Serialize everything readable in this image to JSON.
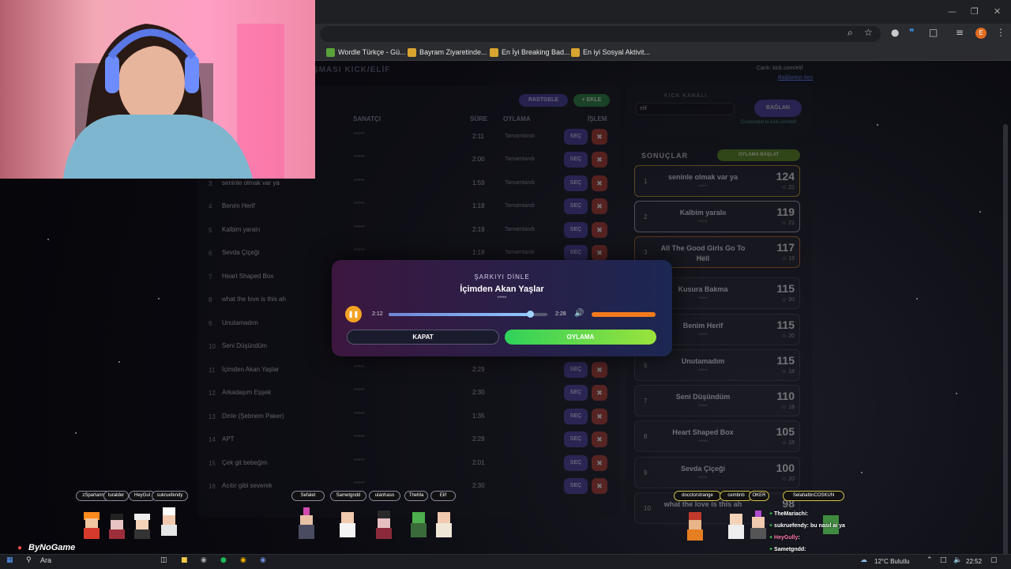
{
  "browser": {
    "bookmarks": [
      {
        "label": "Wordle Türkçe - Gü...",
        "icon": "wordle-icon",
        "color": "#5aa33a"
      },
      {
        "label": "Bayram Ziyaretinde...",
        "icon": "site-icon",
        "color": "#d9a531"
      },
      {
        "label": "En İyi Breaking Bad...",
        "icon": "site-icon",
        "color": "#d9a531"
      },
      {
        "label": "En iyi Sosyal Aktivit...",
        "icon": "site-icon",
        "color": "#d9a531"
      }
    ],
    "profile_initial": "E"
  },
  "page": {
    "title_fragment": "ŞMASI  KICK/ELİF",
    "channel_line": "Canlı: kick.com/elif",
    "disconnect_link": "Bağlantıyı kes",
    "random_button": "RASTGELE",
    "add_button": "+ EKLE",
    "kick_channel_label": "KICK KANALI",
    "kick_input_value": "elif",
    "connect_button": "BAĞLAN",
    "connected_text": "Connected to kick.com/elif",
    "columns": {
      "artist": "SANATÇI",
      "duration": "SÜRE",
      "vote": "OYLAMA",
      "action": "İŞLEM"
    },
    "rows": [
      {
        "num": "",
        "song": "",
        "artist": "*****",
        "dur": "2:11",
        "status": "Tamamlandı"
      },
      {
        "num": "",
        "song": "",
        "artist": "*****",
        "dur": "2:00",
        "status": "Tamamlandı"
      },
      {
        "num": "3",
        "song": "seninle olmak var ya",
        "artist": "*****",
        "dur": "1:59",
        "status": "Tamamlandı"
      },
      {
        "num": "4",
        "song": "Benim Herif",
        "artist": "*****",
        "dur": "1:18",
        "status": "Tamamlandı"
      },
      {
        "num": "5",
        "song": "Kalbim yaralıı",
        "artist": "*****",
        "dur": "2:19",
        "status": "Tamamlandı"
      },
      {
        "num": "6",
        "song": "Sevda Çiçeği",
        "artist": "*****",
        "dur": "1:18",
        "status": "Tamamlandı"
      },
      {
        "num": "7",
        "song": "Heart Shaped Box",
        "artist": "",
        "dur": "",
        "status": ""
      },
      {
        "num": "8",
        "song": "what the love is this ah",
        "artist": "",
        "dur": "",
        "status": ""
      },
      {
        "num": "9",
        "song": "Unutamadım",
        "artist": "",
        "dur": "",
        "status": ""
      },
      {
        "num": "10",
        "song": "Seni Düşündüm",
        "artist": "",
        "dur": "",
        "status": ""
      },
      {
        "num": "11",
        "song": "İçimden Akan Yaşlar",
        "artist": "*****",
        "dur": "2:29",
        "status": ""
      },
      {
        "num": "12",
        "song": "Arkadaşım Eşşek",
        "artist": "*****",
        "dur": "2:30",
        "status": ""
      },
      {
        "num": "13",
        "song": "Dinle (Şebnem Paker)",
        "artist": "*****",
        "dur": "1:35",
        "status": ""
      },
      {
        "num": "14",
        "song": "APT",
        "artist": "*****",
        "dur": "2:29",
        "status": ""
      },
      {
        "num": "15",
        "song": "Çek git bebeğim",
        "artist": "*****",
        "dur": "2:01",
        "status": ""
      },
      {
        "num": "16",
        "song": "Acıtır gibi severek",
        "artist": "*****",
        "dur": "2:30",
        "status": ""
      }
    ],
    "select_label": "SEÇ",
    "results_title": "SONUÇLAR",
    "results_badge": "OYLAMA BAŞLAT",
    "results": [
      {
        "rank": "1",
        "name": "seninle olmak var ya",
        "artist": "*****",
        "score": "124",
        "votes": "22",
        "tier": "gold"
      },
      {
        "rank": "2",
        "name": "Kalbim yaralıı",
        "artist": "*****",
        "score": "119",
        "votes": "21",
        "tier": "silver"
      },
      {
        "rank": "3",
        "name": "All The Good Girls Go To Hell",
        "artist": "*****",
        "score": "117",
        "votes": "19",
        "tier": "bronze"
      },
      {
        "rank": "",
        "name": "Kusura Bakma",
        "artist": "*****",
        "score": "115",
        "votes": "20",
        "tier": ""
      },
      {
        "rank": "",
        "name": "Benim Herif",
        "artist": "*****",
        "score": "115",
        "votes": "20",
        "tier": ""
      },
      {
        "rank": "6",
        "name": "Unutamadım",
        "artist": "*****",
        "score": "115",
        "votes": "18",
        "tier": ""
      },
      {
        "rank": "7",
        "name": "Seni Düşündüm",
        "artist": "*****",
        "score": "110",
        "votes": "18",
        "tier": ""
      },
      {
        "rank": "8",
        "name": "Heart Shaped Box",
        "artist": "*****",
        "score": "105",
        "votes": "18",
        "tier": ""
      },
      {
        "rank": "9",
        "name": "Sevda Çiçeği",
        "artist": "*****",
        "score": "100",
        "votes": "20",
        "tier": ""
      },
      {
        "rank": "10",
        "name": "what the love is this ah",
        "artist": "",
        "score": "98",
        "votes": "",
        "tier": ""
      }
    ]
  },
  "modal": {
    "label": "ŞARKIYI DİNLE",
    "song": "İçimden Akan Yaşlar",
    "artist": "*****",
    "current_time": "2:12",
    "total_time": "2:28",
    "progress": 0.89,
    "volume": 1.0,
    "close_button": "KAPAT",
    "vote_button": "OYLAMA"
  },
  "overlay": {
    "left_chips": [
      "zSpartann",
      "turalder",
      "HeyGul",
      "sukruefendy"
    ],
    "mid_chips": [
      "Sefalet",
      "Sametgndd",
      "ulanhaso",
      "TheMa",
      "Elif"
    ],
    "right_chips": [
      "docctorstrange",
      "cembnb",
      "OKER",
      "SelahattinCOSKUN"
    ],
    "chat": [
      {
        "user": "TheMariachi",
        "text": ":",
        "color": "#ffffff"
      },
      {
        "user": "sukruefendy",
        "text": ": bu nasıl ai ya",
        "color": "#ffffff"
      },
      {
        "user": "HeyGully",
        "text": ":",
        "color": "#ff7aa8"
      },
      {
        "user": "Sametgndd",
        "text": ":",
        "color": "#ffffff"
      },
      {
        "user": "zSpartann",
        "text": ":",
        "color": "#ff3a3a"
      }
    ],
    "brand": "ByNoGame"
  },
  "taskbar": {
    "search_label": "Ara",
    "weather": "12°C  Bulutlu",
    "clock": "22:52"
  }
}
